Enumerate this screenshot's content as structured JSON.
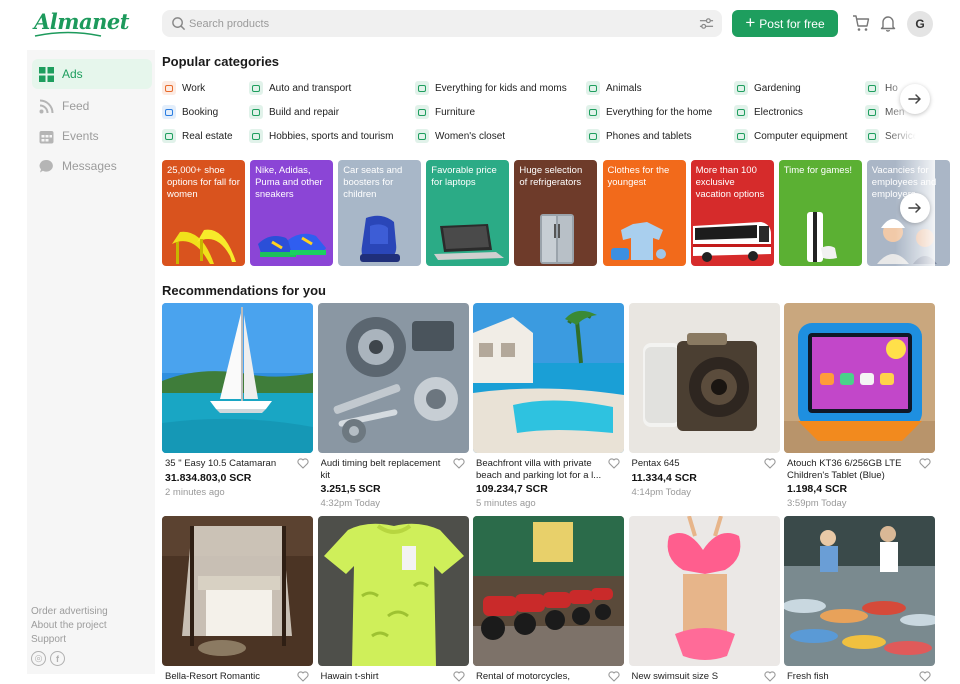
{
  "header": {
    "logo": "Almanet",
    "search_placeholder": "Search products",
    "post_button": "Post for free",
    "avatar_initial": "G",
    "accent_color": "#1e9e5e"
  },
  "sidebar": {
    "items": [
      {
        "label": "Ads",
        "icon": "grid-icon",
        "active": true
      },
      {
        "label": "Feed",
        "icon": "rss-icon",
        "active": false
      },
      {
        "label": "Events",
        "icon": "calendar-icon",
        "active": false
      },
      {
        "label": "Messages",
        "icon": "chat-icon",
        "active": false
      }
    ],
    "links": [
      "Order advertising",
      "About the project",
      "Support"
    ],
    "social": [
      "instagram-icon",
      "facebook-icon"
    ]
  },
  "categories": {
    "title": "Popular categories",
    "items": [
      {
        "label": "Work",
        "icon": "briefcase-icon",
        "color": "#e86a2a"
      },
      {
        "label": "Auto and transport",
        "icon": "car-icon",
        "color": "#1e9e5e"
      },
      {
        "label": "Everything for kids and moms",
        "icon": "stroller-icon",
        "color": "#1e9e5e"
      },
      {
        "label": "Animals",
        "icon": "paw-icon",
        "color": "#1e9e5e"
      },
      {
        "label": "Gardening",
        "icon": "plant-icon",
        "color": "#1e9e5e"
      },
      {
        "label": "Ho",
        "icon": "house-icon",
        "color": "#1e9e5e"
      },
      {
        "label": "Booking",
        "icon": "bed-icon",
        "color": "#2a7de1"
      },
      {
        "label": "Build and repair",
        "icon": "wrench-icon",
        "color": "#1e9e5e"
      },
      {
        "label": "Furniture",
        "icon": "sofa-icon",
        "color": "#1e9e5e"
      },
      {
        "label": "Everything for the home",
        "icon": "home-icon",
        "color": "#1e9e5e"
      },
      {
        "label": "Electronics",
        "icon": "camera-icon",
        "color": "#1e9e5e"
      },
      {
        "label": "Men",
        "icon": "shirt-icon",
        "color": "#1e9e5e"
      },
      {
        "label": "Real estate",
        "icon": "building-icon",
        "color": "#1e9e5e"
      },
      {
        "label": "Hobbies, sports and tourism",
        "icon": "ball-icon",
        "color": "#1e9e5e"
      },
      {
        "label": "Women's closet",
        "icon": "dress-icon",
        "color": "#1e9e5e"
      },
      {
        "label": "Phones and tablets",
        "icon": "phone-icon",
        "color": "#1e9e5e"
      },
      {
        "label": "Computer equipment",
        "icon": "laptop-icon",
        "color": "#1e9e5e"
      },
      {
        "label": "Services",
        "icon": "tools-icon",
        "color": "#1e9e5e"
      }
    ]
  },
  "promos": [
    {
      "text": "25,000+ shoe options for fall for women",
      "color": "#d9531e",
      "art": "heels"
    },
    {
      "text": "Nike, Adidas, Puma and other sneakers",
      "color": "#8b45d6",
      "art": "sneakers"
    },
    {
      "text": "Car seats and boosters for children",
      "color": "#a8b7c8",
      "art": "carseat"
    },
    {
      "text": "Favorable price for laptops",
      "color": "#2bab86",
      "art": "laptop"
    },
    {
      "text": "Huge selection of refrigerators",
      "color": "#6e3b2a",
      "art": "fridge"
    },
    {
      "text": "Clothes for the youngest",
      "color": "#f26a1b",
      "art": "babyclothes"
    },
    {
      "text": "More than 100 exclusive vacation options",
      "color": "#d62b2b",
      "art": "bus"
    },
    {
      "text": "Time for games!",
      "color": "#5bb033",
      "art": "console"
    },
    {
      "text": "Vacancies for employees and employers",
      "color": "#aab6c6",
      "art": "people"
    }
  ],
  "recommendations": {
    "title": "Recommendations for you",
    "cards": [
      {
        "title": "35 \" Easy 10.5 Catamaran",
        "price": "31.834.803,0 SCR",
        "time": "2 minutes ago",
        "image": "catamaran"
      },
      {
        "title": "Audi timing belt replacement kit",
        "price": "3.251,5 SCR",
        "time": "4:32pm Today",
        "image": "parts"
      },
      {
        "title": "Beachfront villa with private beach and parking lot for a l...",
        "price": "109.234,7 SCR",
        "time": "5 minutes ago",
        "image": "villa"
      },
      {
        "title": "Pentax 645",
        "price": "11.334,4 SCR",
        "time": "4:14pm Today",
        "image": "camera"
      },
      {
        "title": "Atouch KT36 6/256GB LTE Children's Tablet (Blue)",
        "price": "1.198,4 SCR",
        "time": "3:59pm Today",
        "image": "tablet"
      },
      {
        "title": "Bella-Resort Romantic",
        "price": "",
        "time": "",
        "image": "resort"
      },
      {
        "title": "Hawain t-shirt",
        "price": "",
        "time": "",
        "image": "tshirt"
      },
      {
        "title": "Rental of motorcycles,",
        "price": "",
        "time": "",
        "image": "motorcycles"
      },
      {
        "title": "New swimsuit size S",
        "price": "",
        "time": "",
        "image": "swimsuit"
      },
      {
        "title": "Fresh fish",
        "price": "",
        "time": "",
        "image": "fish"
      }
    ]
  }
}
